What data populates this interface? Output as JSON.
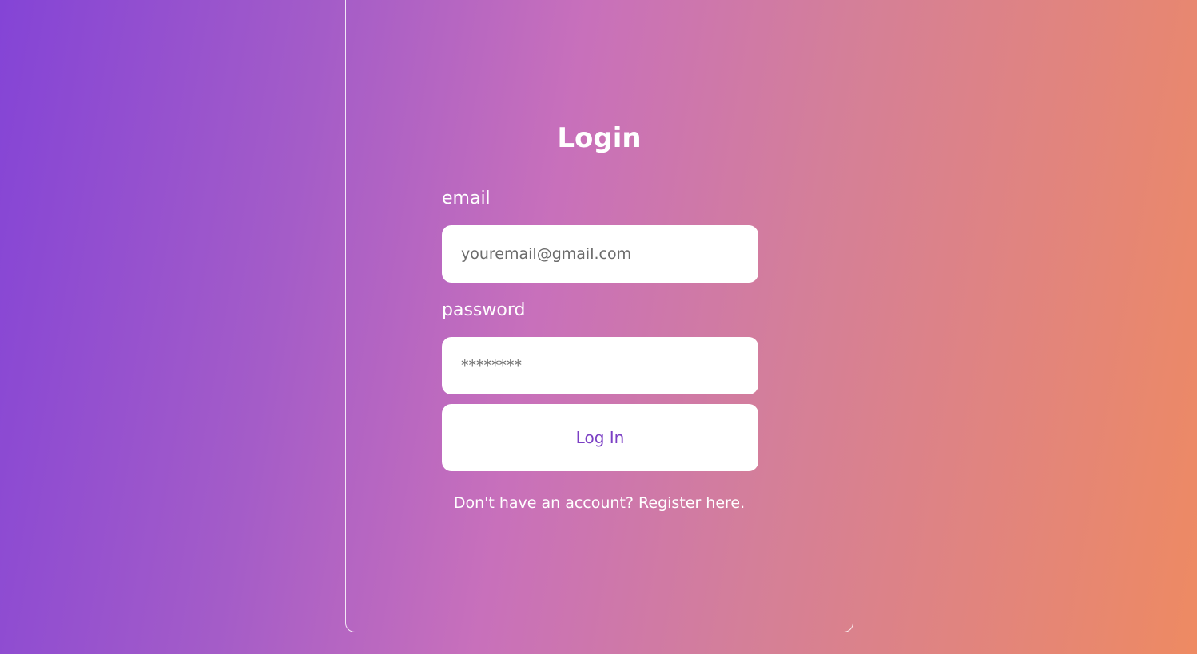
{
  "login": {
    "title": "Login",
    "email_label": "email",
    "email_placeholder": "youremail@gmail.com",
    "password_label": "password",
    "password_placeholder": "********",
    "submit_label": "Log In",
    "register_link": "Don't have an account? Register here."
  },
  "colors": {
    "gradient_start": "#8444d6",
    "gradient_end": "#ee8a62",
    "button_text": "#7b3fc4"
  }
}
